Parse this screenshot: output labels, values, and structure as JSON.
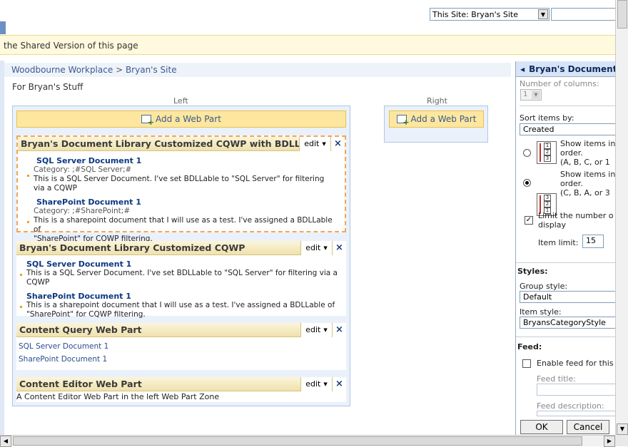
{
  "header": {
    "scope_select_value": "This Site: Bryan's Site",
    "notice": "the Shared Version of this page"
  },
  "breadcrumb": {
    "root": "Woodbourne Workplace",
    "separator": ">",
    "current": "Bryan's Site"
  },
  "page_description": "For Bryan's Stuff",
  "zones": {
    "left_label": "Left",
    "right_label": "Right",
    "add_web_part_label": "Add a Web Part"
  },
  "web_parts": [
    {
      "title": "Bryan's Document Library Customized CQWP with BDLLabel",
      "edit_label": "edit",
      "items": [
        {
          "title": "SQL Server Document 1",
          "category": "Category: ;#SQL Server;#",
          "description": "This is a SQL Server Document. I've set BDLLable to \"SQL Server\" for filtering via a CQWP"
        },
        {
          "title": "SharePoint Document 1",
          "category": "Category: ;#SharePoint;#",
          "description_line1": "This is a sharepoint document that I will use as a test. I've assigned a BDLLable of",
          "description_line2": "\"SharePoint\" for CQWP filtering."
        }
      ]
    },
    {
      "title": "Bryan's Document Library Customized CQWP",
      "edit_label": "edit",
      "items": [
        {
          "title": "SQL Server Document 1",
          "description": "This is a SQL Server Document. I've set BDLLable to \"SQL Server\" for filtering via a CQWP"
        },
        {
          "title": "SharePoint Document 1",
          "description_line1": "This is a sharepoint document that I will use as a test. I've assigned a BDLLable of",
          "description_line2": "\"SharePoint\" for CQWP filtering."
        }
      ]
    },
    {
      "title": "Content Query Web Part",
      "edit_label": "edit",
      "links": [
        "SQL Server Document 1",
        "SharePoint Document 1"
      ]
    },
    {
      "title": "Content Editor Web Part",
      "edit_label": "edit",
      "body_text": "A Content Editor Web Part in the left Web Part Zone"
    }
  ],
  "tool_pane": {
    "title": "Bryan's Document",
    "number_of_columns_label": "Number of columns:",
    "number_of_columns_value": "1",
    "sort_items_by_label": "Sort items by:",
    "sort_items_by_value": "Created",
    "sort_asc": {
      "line1": "Show items in",
      "line2": "order.",
      "line3": "(A, B, C, or 1",
      "icon_nums": [
        "1",
        "2",
        "3"
      ]
    },
    "sort_desc": {
      "line1": "Show items in",
      "line2": "order.",
      "line3": "(C, B, A, or 3",
      "icon_nums": [
        "3",
        "2",
        "1"
      ]
    },
    "limit_label_line1": "Limit the number o",
    "limit_label_line2": "display",
    "item_limit_label": "Item limit:",
    "item_limit_value": "15",
    "styles_heading": "Styles:",
    "group_style_label": "Group style:",
    "group_style_value": "Default",
    "item_style_label": "Item style:",
    "item_style_value": "BryansCategoryStyle",
    "feed_heading": "Feed:",
    "enable_feed_label": "Enable feed for this",
    "feed_title_label": "Feed title:",
    "feed_description_label": "Feed description:",
    "ok_label": "OK",
    "cancel_label": "Cancel"
  }
}
